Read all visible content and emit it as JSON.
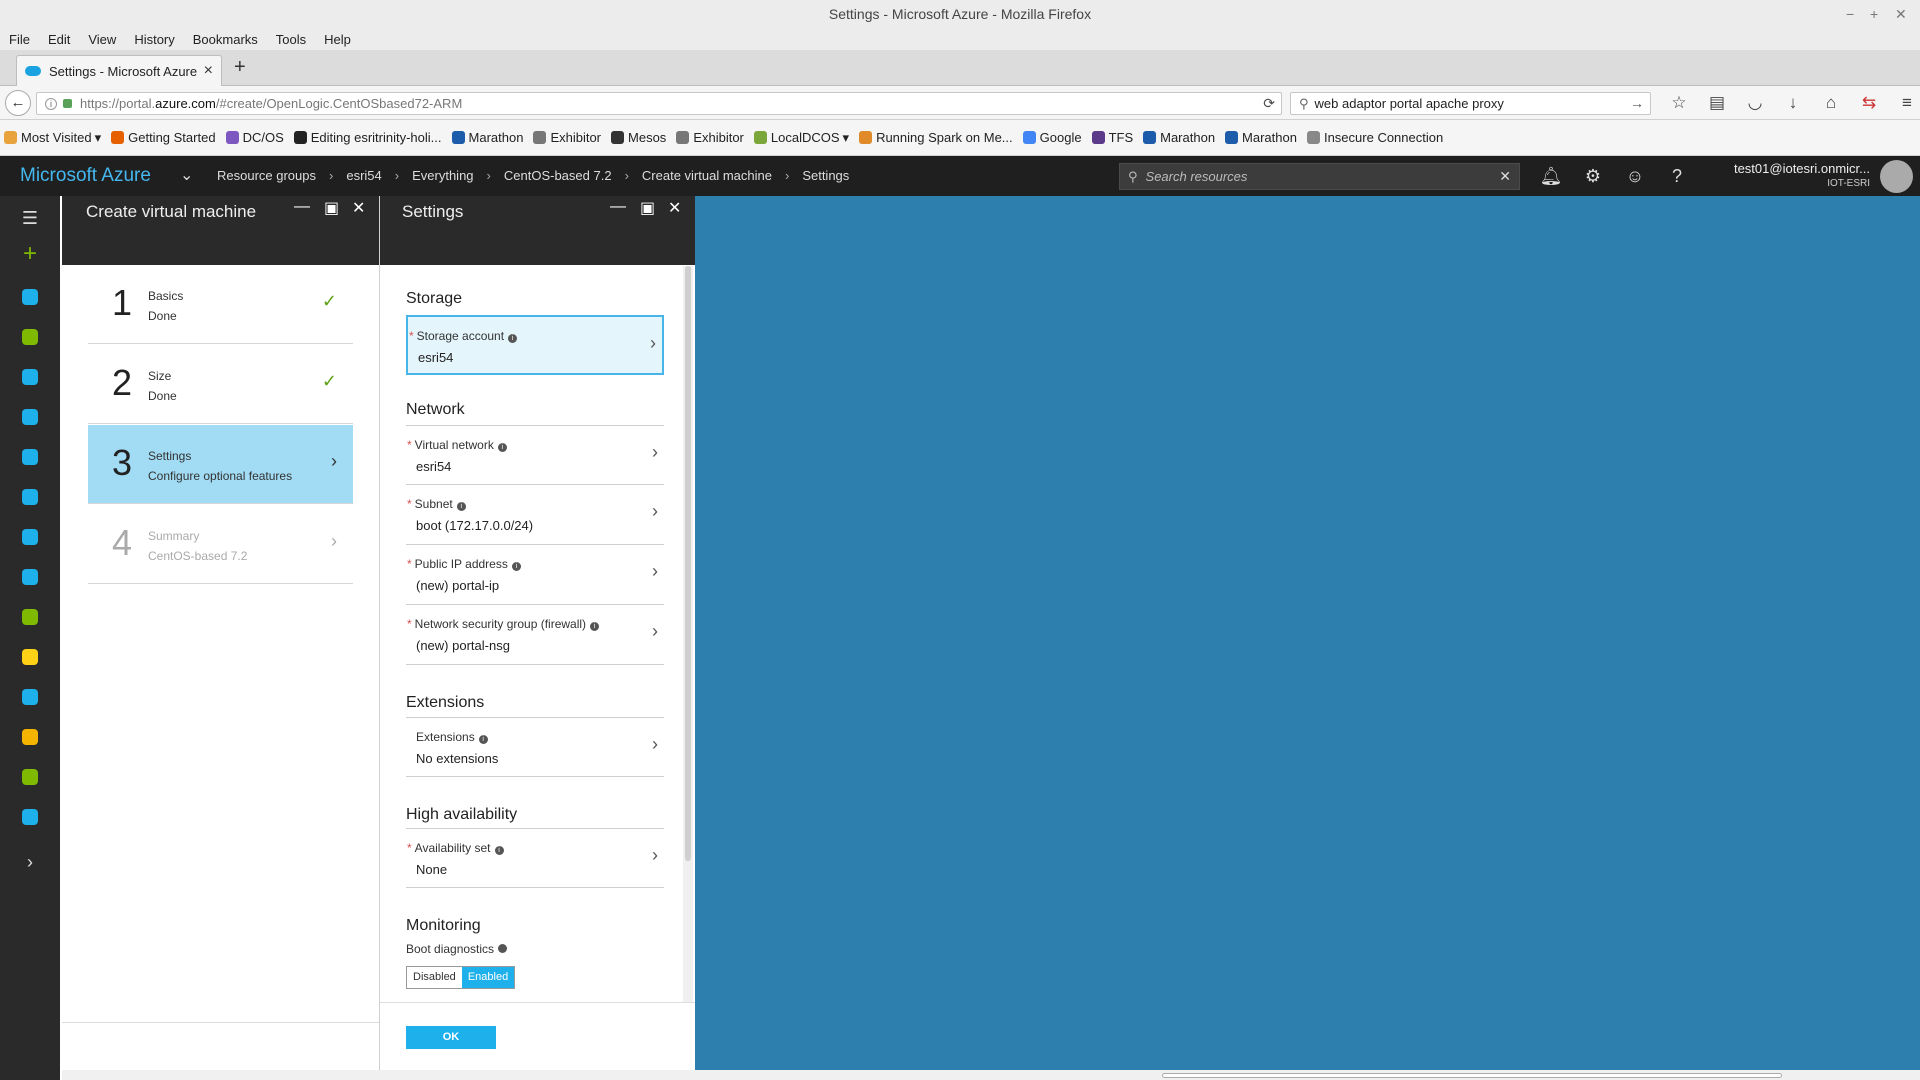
{
  "window": {
    "title": "Settings - Microsoft Azure - Mozilla Firefox"
  },
  "menu": [
    "File",
    "Edit",
    "View",
    "History",
    "Bookmarks",
    "Tools",
    "Help"
  ],
  "tab": {
    "title": "Settings - Microsoft Azure"
  },
  "url": {
    "prefix": "https://portal.",
    "domain": "azure.com",
    "rest": "/#create/OpenLogic.CentOSbased72-ARM"
  },
  "search": {
    "value": "web adaptor portal apache proxy"
  },
  "bookmarks": [
    {
      "label": "Most Visited",
      "color": "#e8a33d",
      "dropdown": true
    },
    {
      "label": "Getting Started",
      "color": "#e66000"
    },
    {
      "label": "DC/OS",
      "color": "#7d58c0"
    },
    {
      "label": "Editing esritrinity-holi...",
      "color": "#222222"
    },
    {
      "label": "Marathon",
      "color": "#1c5cab"
    },
    {
      "label": "Exhibitor",
      "color": "#777777"
    },
    {
      "label": "Mesos",
      "color": "#333333"
    },
    {
      "label": "Exhibitor",
      "color": "#777777"
    },
    {
      "label": "LocalDCOS",
      "color": "#7aa63a",
      "dropdown": true
    },
    {
      "label": "Running Spark on Me...",
      "color": "#e08a2a"
    },
    {
      "label": "Google",
      "color": "#4285f4"
    },
    {
      "label": "TFS",
      "color": "#5b3a8a"
    },
    {
      "label": "Marathon",
      "color": "#1c5cab"
    },
    {
      "label": "Marathon",
      "color": "#1c5cab"
    },
    {
      "label": "Insecure Connection",
      "color": "#888888"
    }
  ],
  "azure": {
    "brand": "Microsoft Azure",
    "breadcrumbs": [
      "Resource groups",
      "esri54",
      "Everything",
      "CentOS-based 7.2",
      "Create virtual machine",
      "Settings"
    ],
    "search_placeholder": "Search resources",
    "account": {
      "user": "test01@iotesri.onmicr...",
      "org": "IOT-ESRI"
    }
  },
  "leftnav_colors": [
    "#1eb0ea",
    "#7fba00",
    "#1eb0ea",
    "#1eb0ea",
    "#1eb0ea",
    "#1eb0ea",
    "#1eb0ea",
    "#1eb0ea",
    "#7fba00",
    "#fcd116",
    "#1eb0ea",
    "#f4b400",
    "#7fba00",
    "#1eb0ea"
  ],
  "blade1": {
    "title": "Create virtual machine",
    "steps": [
      {
        "num": "1",
        "name": "Basics",
        "sub": "Done",
        "state": "done"
      },
      {
        "num": "2",
        "name": "Size",
        "sub": "Done",
        "state": "done"
      },
      {
        "num": "3",
        "name": "Settings",
        "sub": "Configure optional features",
        "state": "active"
      },
      {
        "num": "4",
        "name": "Summary",
        "sub": "CentOS-based 7.2",
        "state": "pending"
      }
    ]
  },
  "blade2": {
    "title": "Settings",
    "storage": {
      "heading": "Storage",
      "account": {
        "label": "Storage account",
        "value": "esri54"
      }
    },
    "network": {
      "heading": "Network",
      "vnet": {
        "label": "Virtual network",
        "value": "esri54"
      },
      "subnet": {
        "label": "Subnet",
        "value": "boot (172.17.0.0/24)"
      },
      "pip": {
        "label": "Public IP address",
        "value": "(new) portal-ip"
      },
      "nsg": {
        "label": "Network security group (firewall)",
        "value": "(new) portal-nsg"
      }
    },
    "extensions": {
      "heading": "Extensions",
      "ext": {
        "label": "Extensions",
        "value": "No extensions"
      }
    },
    "ha": {
      "heading": "High availability",
      "avset": {
        "label": "Availability set",
        "value": "None"
      }
    },
    "monitoring": {
      "heading": "Monitoring",
      "boot_label": "Boot diagnostics",
      "disabled": "Disabled",
      "enabled": "Enabled"
    },
    "ok": "OK"
  }
}
